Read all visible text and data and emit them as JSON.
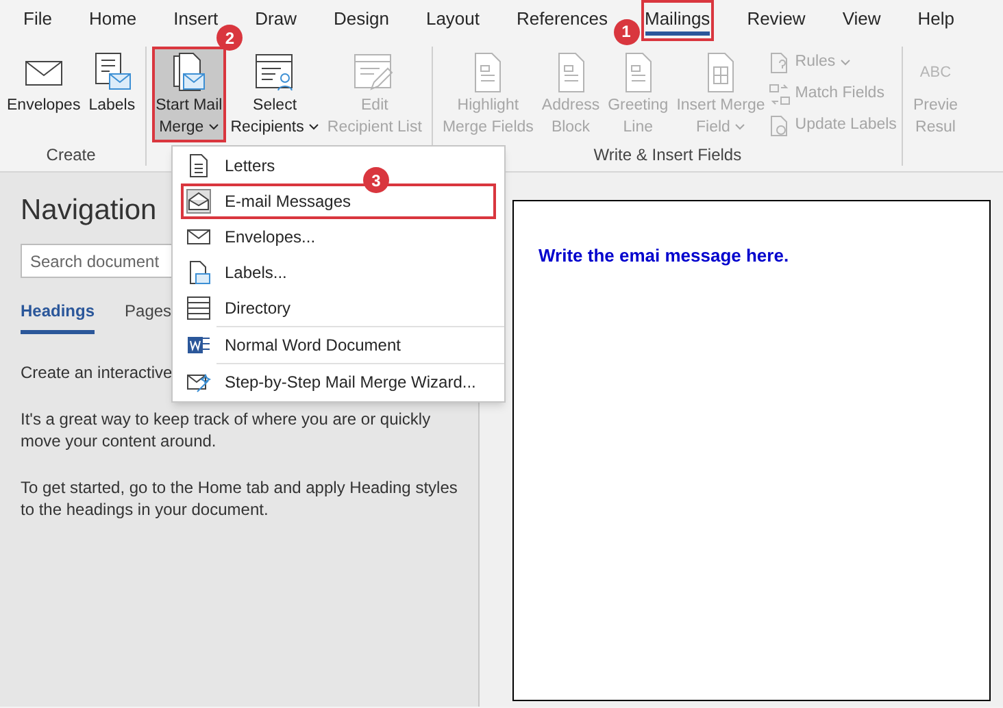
{
  "tabs": [
    {
      "label": "File",
      "selected": false
    },
    {
      "label": "Home",
      "selected": false
    },
    {
      "label": "Insert",
      "selected": false
    },
    {
      "label": "Draw",
      "selected": false
    },
    {
      "label": "Design",
      "selected": false
    },
    {
      "label": "Layout",
      "selected": false
    },
    {
      "label": "References",
      "selected": false
    },
    {
      "label": "Mailings",
      "selected": true,
      "highlighted": true,
      "badge": "1"
    },
    {
      "label": "Review",
      "selected": false
    },
    {
      "label": "View",
      "selected": false
    },
    {
      "label": "Help",
      "selected": false
    }
  ],
  "ribbon": {
    "groups": [
      {
        "label": "Create",
        "buttons": [
          {
            "kind": "large",
            "lines": [
              "Envelopes"
            ],
            "disabled": false
          },
          {
            "kind": "large",
            "lines": [
              "Labels"
            ],
            "disabled": false
          }
        ]
      },
      {
        "buttons": [
          {
            "kind": "large",
            "lines": [
              "Start Mail",
              "Merge"
            ],
            "dropdown": true,
            "disabled": false,
            "pressed": true,
            "highlighted": true,
            "badge": "2"
          },
          {
            "kind": "large",
            "lines": [
              "Select",
              "Recipients"
            ],
            "dropdown": true,
            "disabled": false
          },
          {
            "kind": "large",
            "lines": [
              "Edit",
              "Recipient List"
            ],
            "disabled": true
          }
        ]
      },
      {
        "label": "Write & Insert Fields",
        "buttons": [
          {
            "kind": "large",
            "lines": [
              "Highlight",
              "Merge Fields"
            ],
            "disabled": true
          },
          {
            "kind": "large",
            "lines": [
              "Address",
              "Block"
            ],
            "disabled": true
          },
          {
            "kind": "large",
            "lines": [
              "Greeting",
              "Line"
            ],
            "disabled": true
          },
          {
            "kind": "large",
            "lines": [
              "Insert Merge",
              "Field"
            ],
            "dropdown": true,
            "disabled": true
          },
          {
            "kind": "small",
            "label": "Rules",
            "dropdown": true,
            "disabled": true
          },
          {
            "kind": "small",
            "label": "Match Fields",
            "disabled": true
          },
          {
            "kind": "small",
            "label": "Update Labels",
            "disabled": true
          }
        ]
      },
      {
        "buttons": [
          {
            "kind": "large",
            "icon_text": "ABC",
            "lines": [
              "Previe",
              "Resul"
            ],
            "disabled": true
          }
        ]
      }
    ]
  },
  "menu": {
    "items": [
      {
        "label": "Letters",
        "highlighted": false
      },
      {
        "label": "E-mail Messages",
        "highlighted": true,
        "badge": "3"
      },
      {
        "label": "Envelopes...",
        "highlighted": false
      },
      {
        "label": "Labels...",
        "highlighted": false
      },
      {
        "label": "Directory",
        "highlighted": false
      },
      {
        "label": "Normal Word Document",
        "highlighted": false,
        "divider_before": true
      },
      {
        "label": "Step-by-Step Mail Merge Wizard...",
        "highlighted": false,
        "divider_before": true
      }
    ]
  },
  "navigation": {
    "title": "Navigation",
    "search": {
      "placeholder": "Search document"
    },
    "tabs": [
      {
        "label": "Headings",
        "selected": true
      },
      {
        "label": "Pages",
        "selected": false
      }
    ],
    "paragraphs": [
      "Create an interactive",
      "It's a great way to keep track of where you are or quickly move your content around.",
      "To get started, go to the Home tab and apply Heading styles to the headings in your document."
    ]
  },
  "document": {
    "text": "Write the emai message here."
  }
}
